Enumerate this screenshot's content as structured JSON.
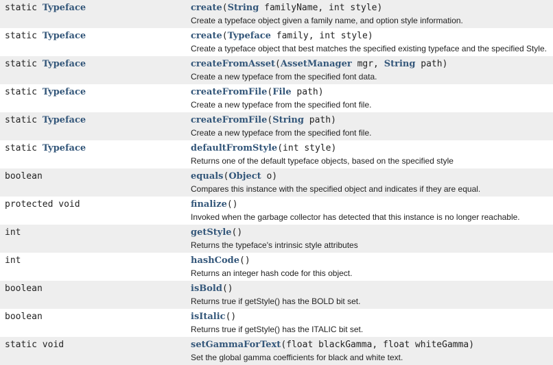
{
  "colors": {
    "link": "#34577a",
    "row_alt": "#eeeeee"
  },
  "rows": [
    {
      "mod": "static ",
      "ret": "Typeface",
      "name": "create",
      "params": [
        {
          "t": "String",
          "l": true
        },
        {
          "t": " familyName, int style",
          "l": false
        }
      ],
      "desc": "Create a typeface object given a family name, and option style information."
    },
    {
      "mod": "static ",
      "ret": "Typeface",
      "name": "create",
      "params": [
        {
          "t": "Typeface",
          "l": true
        },
        {
          "t": " family, int style",
          "l": false
        }
      ],
      "desc": "Create a typeface object that best matches the specified existing typeface and the specified Style."
    },
    {
      "mod": "static ",
      "ret": "Typeface",
      "name": "createFromAsset",
      "params": [
        {
          "t": "AssetManager",
          "l": true
        },
        {
          "t": " mgr, ",
          "l": false
        },
        {
          "t": "String",
          "l": true
        },
        {
          "t": " path",
          "l": false
        }
      ],
      "desc": "Create a new typeface from the specified font data."
    },
    {
      "mod": "static ",
      "ret": "Typeface",
      "name": "createFromFile",
      "params": [
        {
          "t": "File",
          "l": true
        },
        {
          "t": " path",
          "l": false
        }
      ],
      "desc": "Create a new typeface from the specified font file."
    },
    {
      "mod": "static ",
      "ret": "Typeface",
      "name": "createFromFile",
      "params": [
        {
          "t": "String",
          "l": true
        },
        {
          "t": " path",
          "l": false
        }
      ],
      "desc": "Create a new typeface from the specified font file."
    },
    {
      "mod": "static ",
      "ret": "Typeface",
      "name": "defaultFromStyle",
      "params": [
        {
          "t": "int style",
          "l": false
        }
      ],
      "desc": "Returns one of the default typeface objects, based on the specified style"
    },
    {
      "mod": "boolean",
      "ret": "",
      "name": "equals",
      "params": [
        {
          "t": "Object",
          "l": true
        },
        {
          "t": " o",
          "l": false
        }
      ],
      "desc": "Compares this instance with the specified object and indicates if they are equal."
    },
    {
      "mod": "protected void",
      "ret": "",
      "name": "finalize",
      "params": [],
      "desc": "Invoked when the garbage collector has detected that this instance is no longer reachable."
    },
    {
      "mod": "int",
      "ret": "",
      "name": "getStyle",
      "params": [],
      "desc": "Returns the typeface's intrinsic style attributes"
    },
    {
      "mod": "int",
      "ret": "",
      "name": "hashCode",
      "params": [],
      "desc": "Returns an integer hash code for this object."
    },
    {
      "mod": "boolean",
      "ret": "",
      "name": "isBold",
      "params": [],
      "desc": "Returns true if getStyle() has the BOLD bit set."
    },
    {
      "mod": "boolean",
      "ret": "",
      "name": "isItalic",
      "params": [],
      "desc": "Returns true if getStyle() has the ITALIC bit set."
    },
    {
      "mod": "static void",
      "ret": "",
      "name": "setGammaForText",
      "params": [
        {
          "t": "float blackGamma, float whiteGamma",
          "l": false
        }
      ],
      "desc": "Set the global gamma coefficients for black and white text."
    }
  ]
}
